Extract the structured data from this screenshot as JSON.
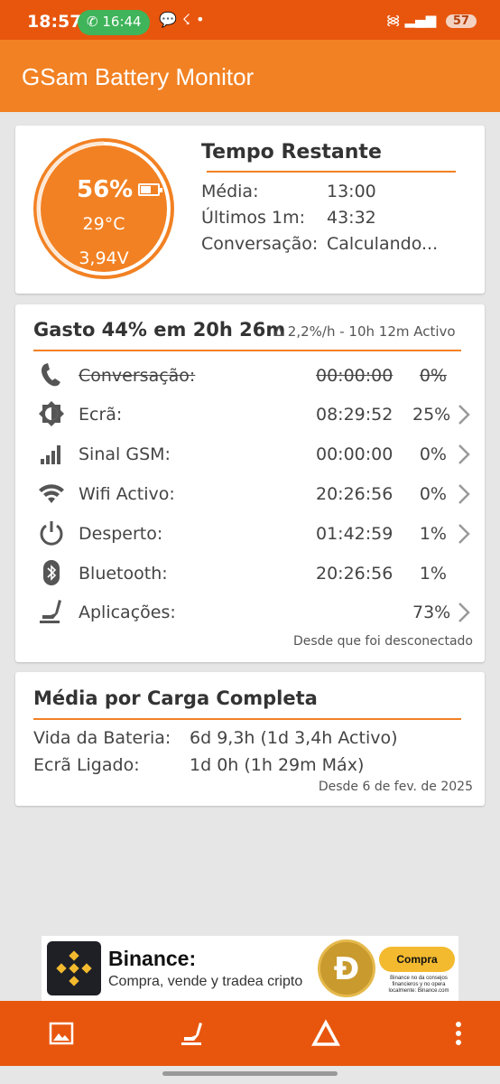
{
  "status_bar": {
    "time": "18:57",
    "call_time": "16:44",
    "battery_level": "57"
  },
  "app": {
    "title": "GSam Battery Monitor"
  },
  "gauge": {
    "percent": "56%",
    "percent_value": 56,
    "temperature": "29°C",
    "voltage": "3,94V"
  },
  "time_remaining": {
    "title": "Tempo Restante",
    "rows": [
      {
        "label": "Média:",
        "value": "13:00"
      },
      {
        "label": "Últimos 1m:",
        "value": "43:32"
      },
      {
        "label": "Conversação:",
        "value": "Calculando..."
      }
    ]
  },
  "usage": {
    "title": "Gasto 44% em 20h 26m",
    "subtitle": "∆ 2,2%/h - 10h 12m Activo",
    "rows": [
      {
        "icon": "phone-icon",
        "label": "Conversação:",
        "time": "00:00:00",
        "percent": "0%",
        "disabled": true,
        "chevron": false
      },
      {
        "icon": "screen-brightness-icon",
        "label": "Ecrã:",
        "time": "08:29:52",
        "percent": "25%",
        "disabled": false,
        "chevron": true
      },
      {
        "icon": "cell-signal-icon",
        "label": "Sinal GSM:",
        "time": "00:00:00",
        "percent": "0%",
        "disabled": false,
        "chevron": true
      },
      {
        "icon": "wifi-icon",
        "label": "Wifi Activo:",
        "time": "20:26:56",
        "percent": "0%",
        "disabled": false,
        "chevron": true
      },
      {
        "icon": "power-icon",
        "label": "Desperto:",
        "time": "01:42:59",
        "percent": "1%",
        "disabled": false,
        "chevron": true
      },
      {
        "icon": "bluetooth-icon",
        "label": "Bluetooth:",
        "time": "20:26:56",
        "percent": "1%",
        "disabled": false,
        "chevron": false
      },
      {
        "icon": "apps-icon",
        "label": "Aplicações:",
        "time": "",
        "percent": "73%",
        "disabled": false,
        "chevron": true
      }
    ],
    "footer": "Desde que foi desconectado"
  },
  "full_charge": {
    "title": "Média por Carga Completa",
    "rows": [
      {
        "label": "Vida da Bateria:",
        "value": "6d 9,3h (1d 3,4h Activo)"
      },
      {
        "label": "Ecrã Ligado:",
        "value": "1d 0h (1h 29m Máx)"
      }
    ],
    "footer": "Desde 6 de fev. de 2025"
  },
  "ad": {
    "title": "Binance:",
    "subtitle": "Compra, vende y tradea cripto",
    "button": "Compra",
    "disclaimer": "Binance no da consejos financieros y no opera localmente: Binance.com"
  },
  "bottom_nav": [
    "image-icon",
    "apps-icon",
    "delta-icon",
    "more-vert-icon"
  ],
  "colors": {
    "status_bar": "#e8560e",
    "app_bar": "#f28123",
    "accent": "#f28123",
    "background": "#e6e6e6"
  }
}
